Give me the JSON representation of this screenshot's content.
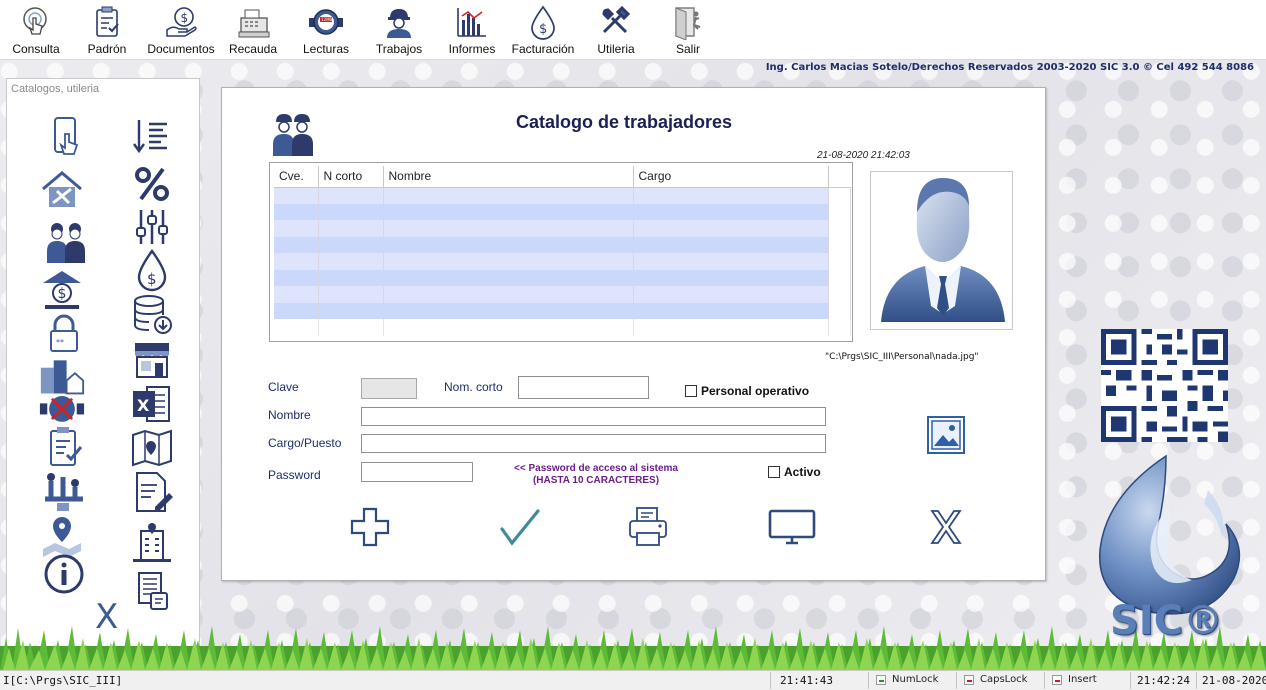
{
  "toolbar": {
    "items": [
      {
        "label": "Consulta",
        "icon": "touch-phone-icon"
      },
      {
        "label": "Padrón",
        "icon": "clipboard-check-icon"
      },
      {
        "label": "Documentos",
        "icon": "money-hand-icon"
      },
      {
        "label": "Recauda",
        "icon": "cash-register-icon"
      },
      {
        "label": "Lecturas",
        "icon": "water-meter-icon"
      },
      {
        "label": "Trabajos",
        "icon": "worker-icon"
      },
      {
        "label": "Informes",
        "icon": "report-chart-icon"
      },
      {
        "label": "Facturación",
        "icon": "water-drop-dollar-icon"
      },
      {
        "label": "Utileria",
        "icon": "tools-icon"
      },
      {
        "label": "Salir",
        "icon": "exit-door-icon"
      }
    ]
  },
  "credits": "Ing. Carlos Macias Sotelo/Derechos Reservados 2003-2020 SIC 3.0 ©  Cel 492 544 8086",
  "side_panel": {
    "title": "Catalogos, utileria",
    "close_label": "X",
    "left_icons": [
      "phone-touch-icon",
      "house-tools-icon",
      "workers-icon",
      "bank-dollar-icon",
      "lock-password-icon",
      "buildings-icon",
      "water-meter-cancel-icon",
      "clipboard-check-icon",
      "pipes-workers-icon",
      "map-pin-icon",
      "info-icon"
    ],
    "right_icons": [
      "sort-list-icon",
      "percent-icon",
      "sliders-icon",
      "water-drop-dollar-icon",
      "database-download-icon",
      "store-icon",
      "excel-icon",
      "map-icon",
      "document-edit-icon",
      "hospital-building-icon",
      "document-list-icon"
    ]
  },
  "form": {
    "title": "Catalogo de trabajadores",
    "datetime": "21-08-2020 21:42:03",
    "grid": {
      "columns": [
        "Cve.",
        "N corto",
        "Nombre",
        "Cargo"
      ],
      "rows": 8
    },
    "photo_path": "\"C:\\Prgs\\SIC_III\\Personal\\nada.jpg\"",
    "fields": {
      "clave_label": "Clave",
      "clave_value": "",
      "nom_corto_label": "Nom. corto",
      "nom_corto_value": "",
      "nombre_label": "Nombre",
      "nombre_value": "",
      "cargo_label": "Cargo/Puesto",
      "cargo_value": "",
      "password_label": "Password",
      "password_value": ""
    },
    "password_note_line1": "<< Password de acceso al sistema",
    "password_note_line2": "(HASTA 10 CARACTERES)",
    "personal_operativo_label": "Personal operativo",
    "personal_operativo_checked": false,
    "activo_label": "Activo",
    "activo_checked": false,
    "actions": [
      "add-icon",
      "check-icon",
      "print-icon",
      "monitor-icon",
      "close-icon"
    ]
  },
  "brand": {
    "logo_text": "SIC®"
  },
  "statusbar": {
    "path": "I[C:\\Prgs\\SIC_III]",
    "time1": "21:41:43",
    "numlock": "NumLock",
    "capslock": "CapsLock",
    "insert": "Insert",
    "time2": "21:42:24",
    "date": "21-08-2020"
  },
  "colors": {
    "primary": "#1f3b73",
    "icon_blue": "#3d5a96",
    "grid_row_a": "#dde4fb",
    "grid_row_b": "#cad8fa",
    "check_teal": "#3f8a9a"
  }
}
